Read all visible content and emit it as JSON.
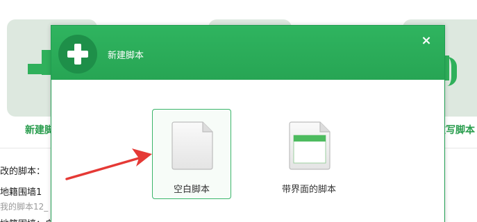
{
  "background": {
    "card_left_caption": "新建脚",
    "card_right_caption": "文写脚本",
    "recent_heading": "改的脚本：",
    "recent_items": [
      {
        "title": "地籍围墙1",
        "subtitle": "我的脚本12_"
      },
      {
        "title": "地籍围墙：白"
      }
    ]
  },
  "dialog": {
    "title": "新建脚本",
    "close_symbol": "×",
    "options": [
      {
        "label": "空白脚本",
        "selected": true
      },
      {
        "label": "带界面的脚本",
        "selected": false
      }
    ]
  },
  "colors": {
    "accent": "#2fb45f",
    "accent_dark": "#1e8f49",
    "arrow": "#e53935"
  }
}
